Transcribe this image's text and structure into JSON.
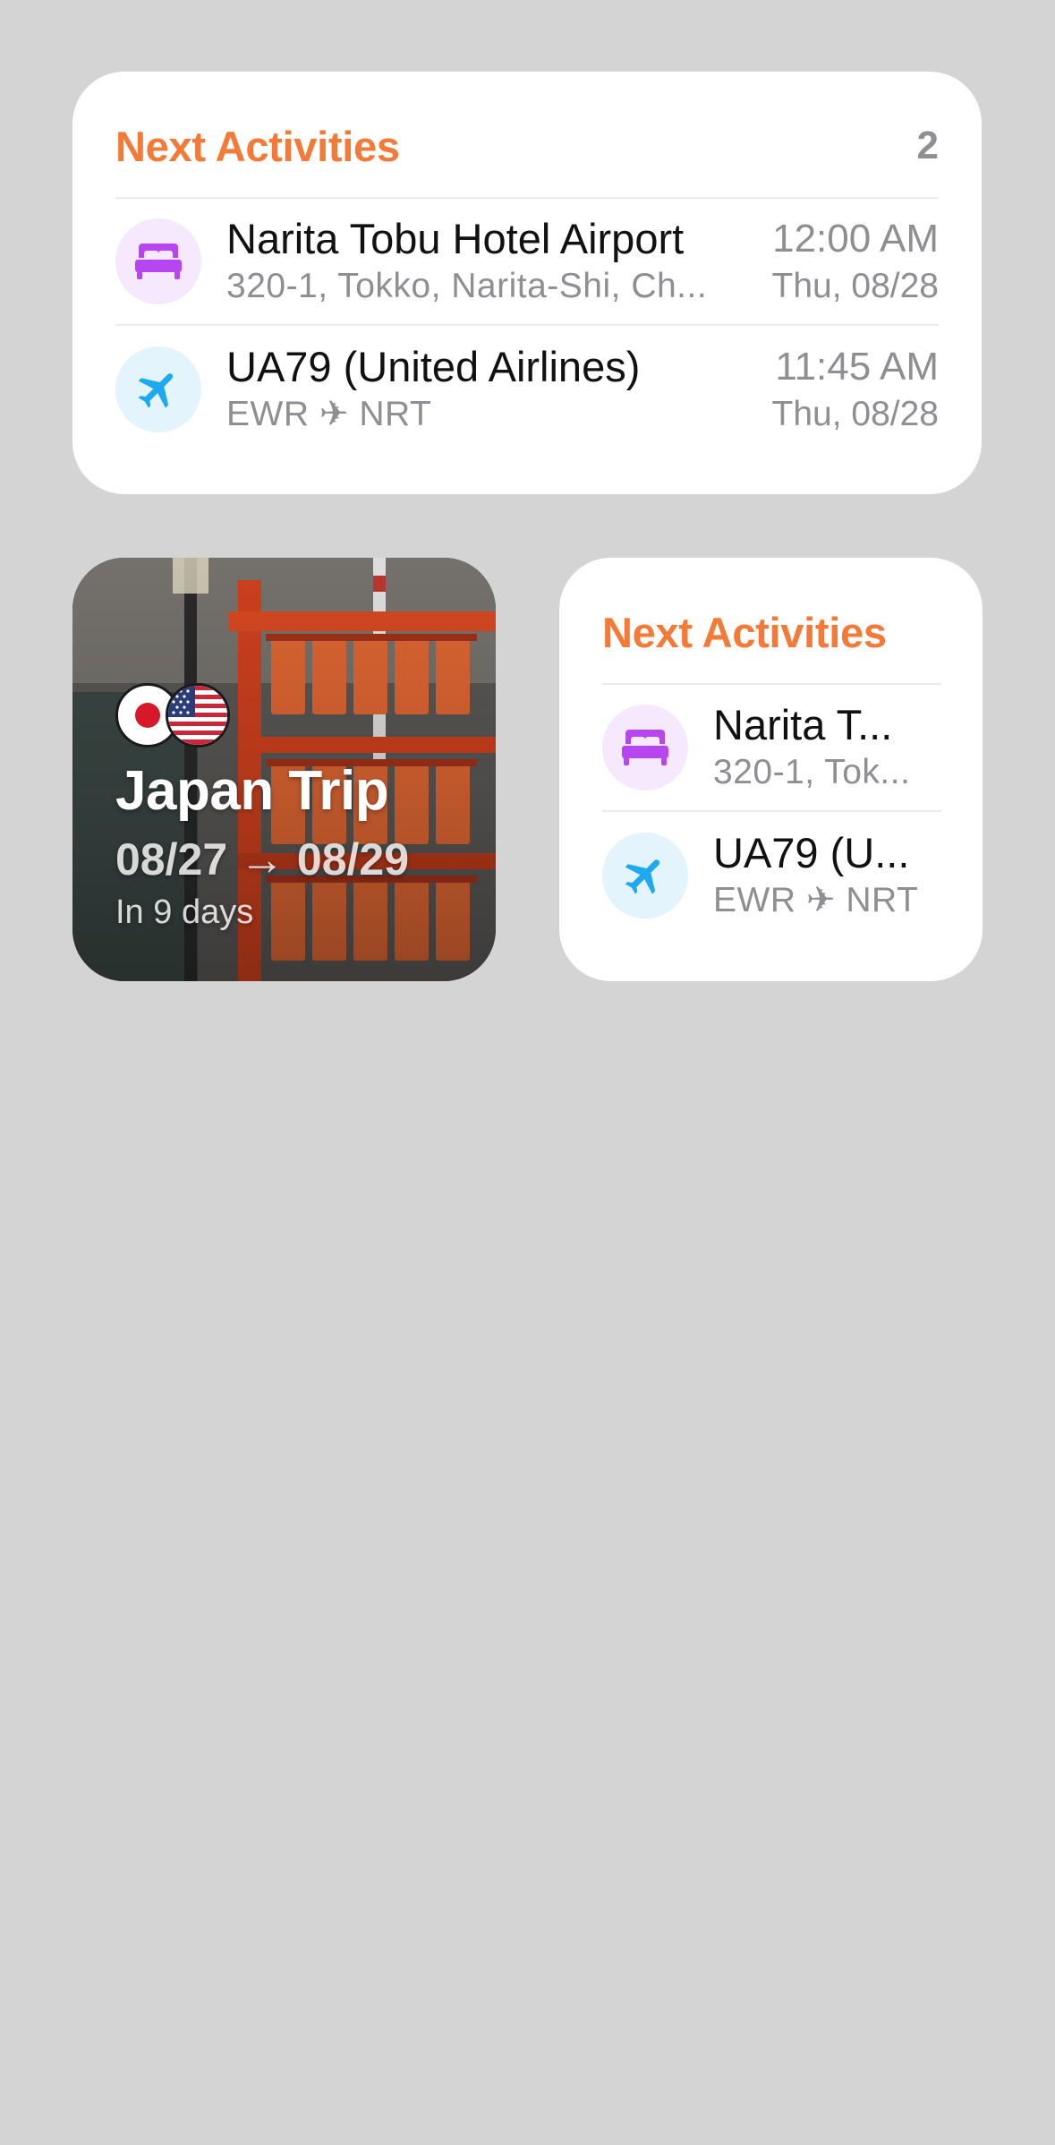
{
  "colors": {
    "accent": "#f47a37",
    "background": "#d4d4d4",
    "hotel_icon": "#b846f0",
    "flight_icon": "#1fa9f0"
  },
  "large_widget": {
    "title": "Next Activities",
    "count": "2",
    "items": [
      {
        "icon": "bed-icon",
        "title": "Narita Tobu Hotel Airport",
        "subtitle": "320-1, Tokko, Narita-Shi, Ch...",
        "time": "12:00 AM",
        "date": "Thu, 08/28"
      },
      {
        "icon": "airplane-icon",
        "title": "UA79 (United Airlines)",
        "subtitle": "EWR ✈ NRT",
        "time": "11:45 AM",
        "date": "Thu, 08/28"
      }
    ]
  },
  "trip_widget": {
    "flags": [
      "japan-flag-icon",
      "us-flag-icon"
    ],
    "title": "Japan Trip",
    "dates": "08/27 → 08/29",
    "countdown": "In 9 days"
  },
  "small_widget": {
    "title": "Next Activities",
    "items": [
      {
        "icon": "bed-icon",
        "title": "Narita T...",
        "subtitle": "320-1, Tok..."
      },
      {
        "icon": "airplane-icon",
        "title": "UA79 (U...",
        "subtitle": "EWR ✈ NRT"
      }
    ]
  }
}
